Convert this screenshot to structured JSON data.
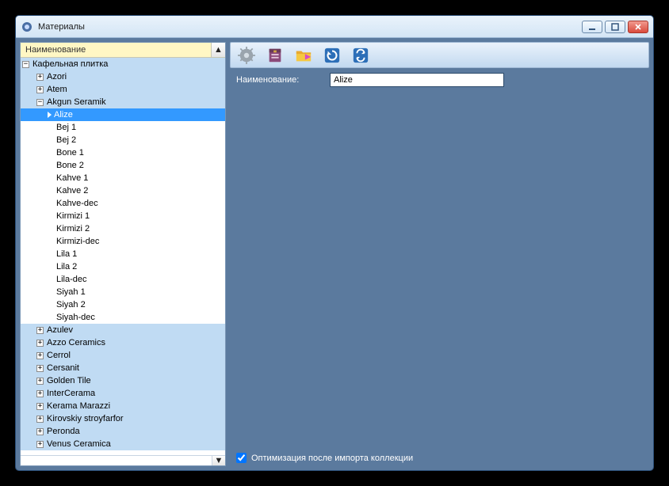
{
  "window": {
    "title": "Материалы"
  },
  "tree": {
    "header_label": "Наименование",
    "scroll_up": "▲",
    "scroll_down": "▼",
    "root": {
      "label": "Кафельная плитка",
      "expander": "−",
      "children": [
        {
          "label": "Azori",
          "expander": "+"
        },
        {
          "label": "Atem",
          "expander": "+"
        },
        {
          "label": "Akgun Seramik",
          "expander": "−",
          "expanded": true,
          "children": [
            {
              "label": "Alize",
              "selected": true
            },
            {
              "label": "Bej 1"
            },
            {
              "label": "Bej 2"
            },
            {
              "label": "Bone 1"
            },
            {
              "label": "Bone 2"
            },
            {
              "label": "Kahve 1"
            },
            {
              "label": "Kahve 2"
            },
            {
              "label": "Kahve-dec"
            },
            {
              "label": "Kirmizi 1"
            },
            {
              "label": "Kirmizi 2"
            },
            {
              "label": "Kirmizi-dec"
            },
            {
              "label": "Lila 1"
            },
            {
              "label": "Lila 2"
            },
            {
              "label": "Lila-dec"
            },
            {
              "label": "Siyah 1"
            },
            {
              "label": "Siyah 2"
            },
            {
              "label": "Siyah-dec"
            }
          ]
        },
        {
          "label": "Azulev",
          "expander": "+"
        },
        {
          "label": "Azzo Ceramics",
          "expander": "+"
        },
        {
          "label": "Cerrol",
          "expander": "+"
        },
        {
          "label": "Cersanit",
          "expander": "+"
        },
        {
          "label": "Golden Tile",
          "expander": "+"
        },
        {
          "label": "InterCerama",
          "expander": "+"
        },
        {
          "label": "Kerama Marazzi",
          "expander": "+"
        },
        {
          "label": "Kirovskiy stroyfarfor",
          "expander": "+"
        },
        {
          "label": "Peronda",
          "expander": "+"
        },
        {
          "label": "Venus Ceramica",
          "expander": "+"
        }
      ]
    }
  },
  "form": {
    "name_label": "Наименование:",
    "name_value": "Alize"
  },
  "footer": {
    "checkbox_label": "Оптимизация после импорта коллекции",
    "checked": true
  },
  "icons": {
    "gear": "gear-icon",
    "archive": "archive-icon",
    "folder": "folder-arrow-icon",
    "refresh1": "reload-blue-icon",
    "refresh2": "reload-alt-icon"
  }
}
